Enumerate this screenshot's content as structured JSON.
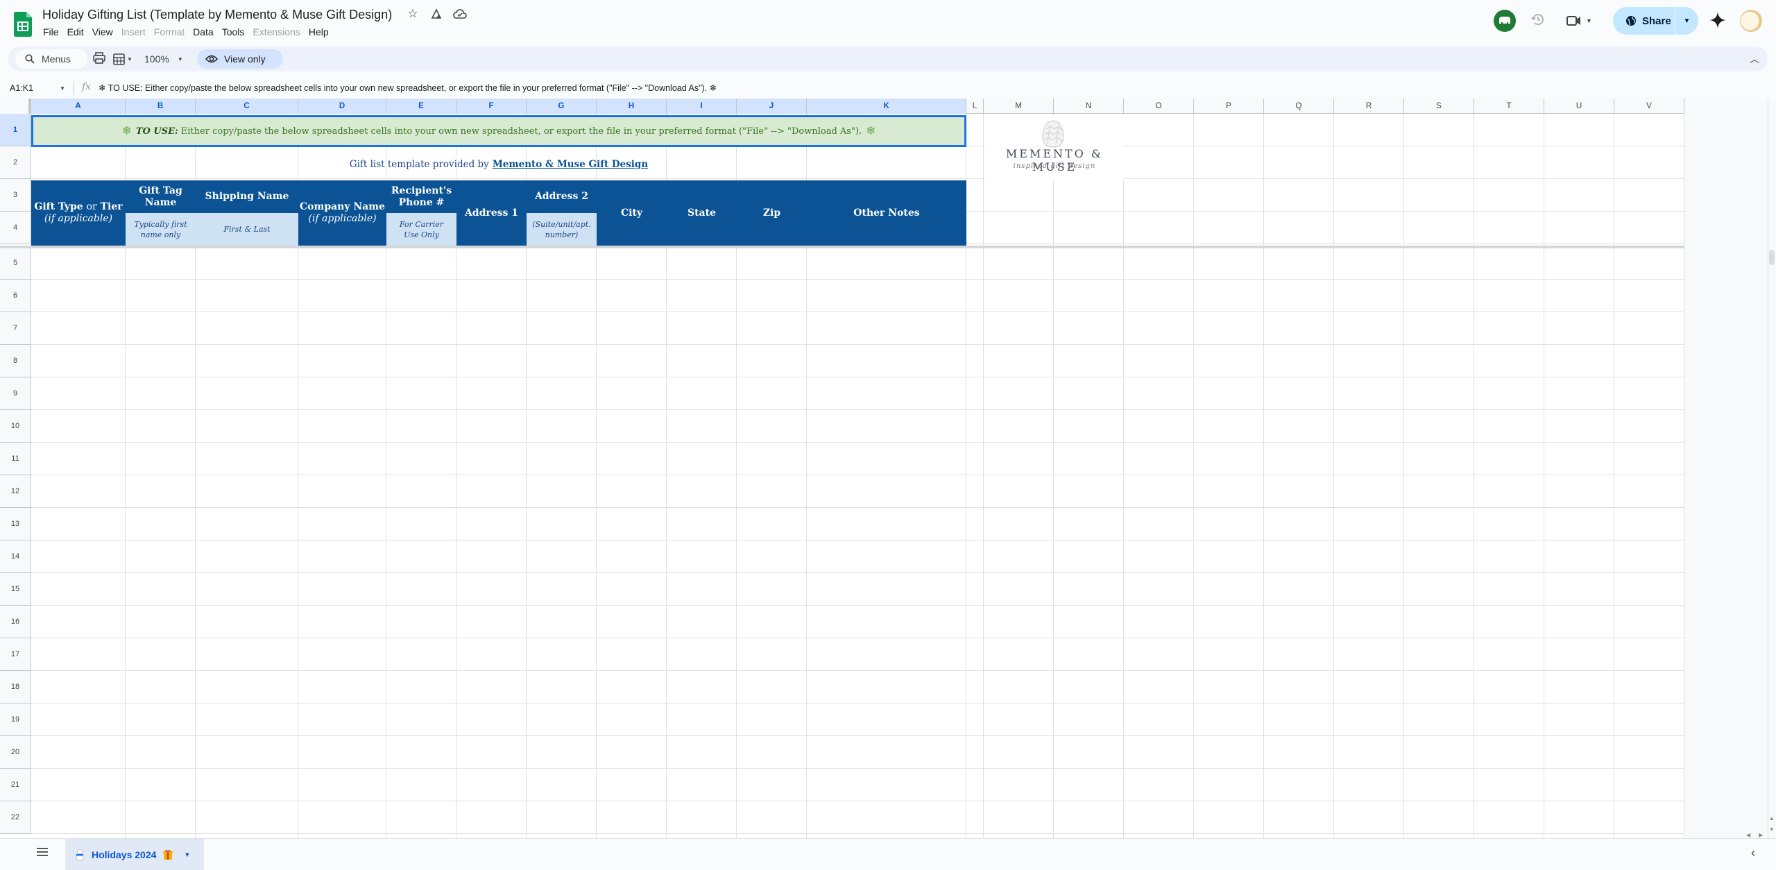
{
  "app": {
    "title": "Holiday Gifting List (Template by Memento & Muse Gift Design)",
    "menu": [
      {
        "label": "File",
        "enabled": true
      },
      {
        "label": "Edit",
        "enabled": true
      },
      {
        "label": "View",
        "enabled": true
      },
      {
        "label": "Insert",
        "enabled": false
      },
      {
        "label": "Format",
        "enabled": false
      },
      {
        "label": "Data",
        "enabled": true
      },
      {
        "label": "Tools",
        "enabled": true
      },
      {
        "label": "Extensions",
        "enabled": false
      },
      {
        "label": "Help",
        "enabled": true
      }
    ],
    "share_label": "Share",
    "brand_color": "#0f9d58",
    "accent_color": "#c2e7ff"
  },
  "toolbar": {
    "menus_label": "Menus",
    "zoom_value": "100%",
    "view_only_label": "View only"
  },
  "formula_bar": {
    "name_box": "A1:K1",
    "fx": "fx",
    "content": "❄ TO USE: Either copy/paste the below spreadsheet cells into your own new spreadsheet, or export the file in your preferred format (\"File\" --> \"Download As\"). ❄"
  },
  "grid": {
    "columns": [
      "A",
      "B",
      "C",
      "D",
      "E",
      "F",
      "G",
      "H",
      "I",
      "J",
      "K",
      "L",
      "M",
      "N",
      "O",
      "P",
      "Q",
      "R",
      "S",
      "T",
      "U",
      "V"
    ],
    "rows": [
      "1",
      "2",
      "3",
      "4",
      "5",
      "6",
      "7",
      "8",
      "9",
      "10",
      "11",
      "12",
      "13",
      "14",
      "15",
      "16",
      "17",
      "18",
      "19",
      "20",
      "21",
      "22"
    ],
    "selection": "A1:K1"
  },
  "sheet": {
    "banner_lead": "TO USE:",
    "banner_text": "Either copy/paste the below spreadsheet cells into your own new spreadsheet, or export the file in your preferred format (\"File\" --> \"Download As\").",
    "credit_text": "Gift list template provided by",
    "credit_link": "Memento & Muse Gift Design",
    "headers": {
      "gift_type_main": "Gift Type",
      "gift_type_or": "or",
      "gift_type_tier": "Tier",
      "gift_type_sub": "(if applicable)",
      "gift_tag": "Gift Tag Name",
      "gift_tag_sub": "Typically first name only",
      "shipping_name": "Shipping Name",
      "shipping_sub": "First & Last",
      "company": "Company Name",
      "company_sub": "(if applicable)",
      "phone": "Recipient's Phone #",
      "phone_sub": "For Carrier Use Only",
      "address1": "Address 1",
      "address2": "Address 2",
      "address2_sub": "(Suite/unit/apt. number)",
      "city": "City",
      "state": "State",
      "zip": "Zip",
      "notes": "Other Notes"
    },
    "header_color": "#0b5394",
    "banner_color": "#d9ead3",
    "logo": {
      "name": "MEMENTO & MUSE",
      "tagline": "inspired gift design"
    }
  },
  "tabs": [
    {
      "label": "Holidays 2024",
      "active": true
    }
  ]
}
